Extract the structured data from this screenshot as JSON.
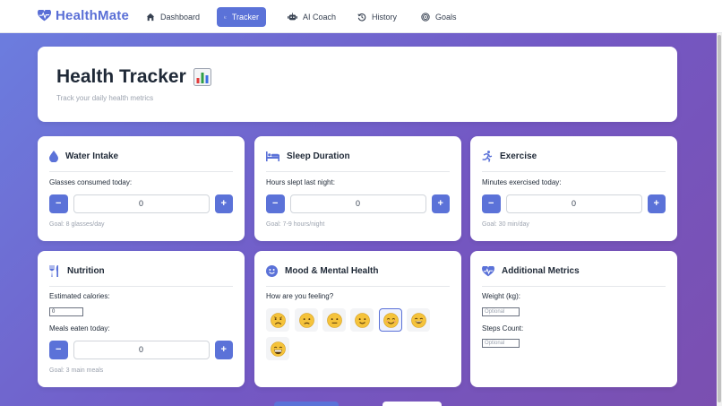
{
  "app": {
    "name": "HealthMate"
  },
  "nav": {
    "items": [
      {
        "label": "Dashboard",
        "icon": "home-icon"
      },
      {
        "label": "Tracker",
        "icon": "chart-icon",
        "active": true
      },
      {
        "label": "AI Coach",
        "icon": "robot-icon"
      },
      {
        "label": "History",
        "icon": "history-icon"
      },
      {
        "label": "Goals",
        "icon": "target-icon"
      }
    ]
  },
  "hero": {
    "title": "Health Tracker",
    "title_emoji": "📊",
    "subtitle": "Track your daily health metrics"
  },
  "water": {
    "title": "Water Intake",
    "label": "Glasses consumed today:",
    "value": "0",
    "goal": "Goal: 8 glasses/day",
    "icon": "droplet-icon"
  },
  "sleep": {
    "title": "Sleep Duration",
    "label": "Hours slept last night:",
    "value": "0",
    "goal": "Goal: 7-9 hours/night",
    "icon": "bed-icon"
  },
  "exercise": {
    "title": "Exercise",
    "label": "Minutes exercised today:",
    "value": "0",
    "goal": "Goal: 30 min/day",
    "icon": "running-icon"
  },
  "nutrition": {
    "title": "Nutrition",
    "icon": "utensils-icon",
    "calories_label": "Estimated calories:",
    "calories_value": "0",
    "meals_label": "Meals eaten today:",
    "meals_value": "0",
    "goal": "Goal: 3 main meals"
  },
  "mood": {
    "title": "Mood & Mental Health",
    "icon": "smile-icon",
    "label": "How are you feeling?",
    "options": [
      "very-sad",
      "sad",
      "neutral",
      "slightly-happy",
      "happy",
      "very-happy",
      "grinning"
    ],
    "selected": "happy"
  },
  "additional": {
    "title": "Additional Metrics",
    "icon": "heartbeat-icon",
    "weight_label": "Weight (kg):",
    "weight_placeholder": "Optional",
    "steps_label": "Steps Count:",
    "steps_placeholder": "Optional"
  },
  "stepper": {
    "minus": "−",
    "plus": "+"
  },
  "colors": {
    "accent": "#5b72d8",
    "brand": "#5a6fd6",
    "emoji_fill": "#f5c33b"
  }
}
